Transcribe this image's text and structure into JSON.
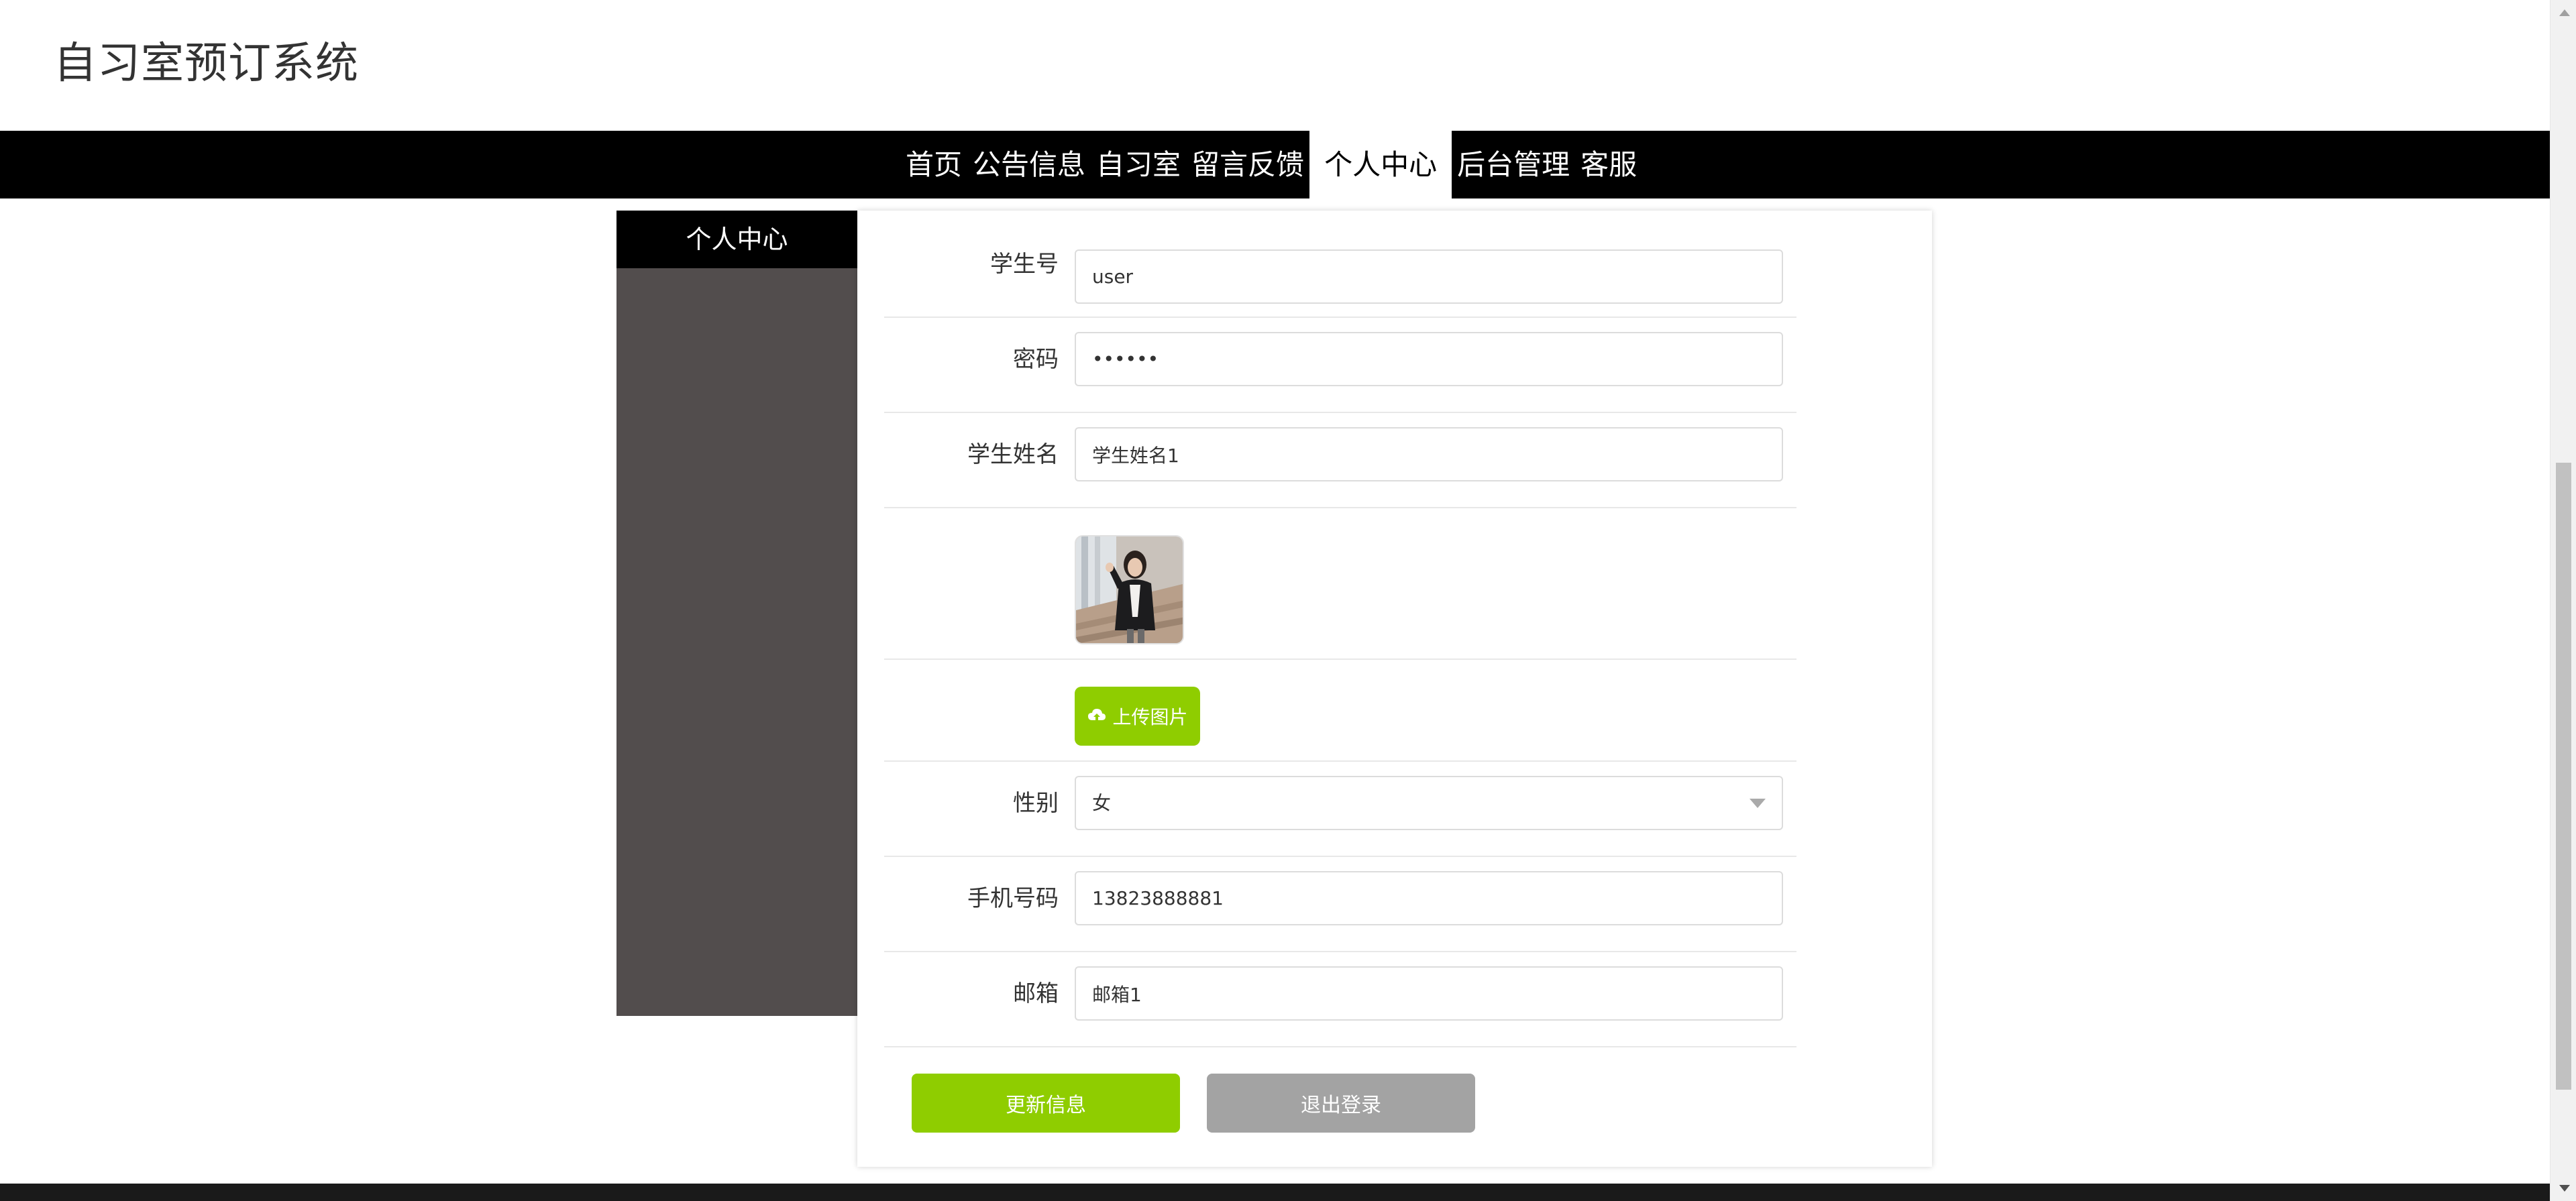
{
  "site": {
    "title": "自习室预订系统"
  },
  "nav": {
    "items": [
      {
        "label": "首页"
      },
      {
        "label": "公告信息"
      },
      {
        "label": "自习室"
      },
      {
        "label": "留言反馈"
      },
      {
        "label": "个人中心",
        "active": true
      },
      {
        "label": "后台管理"
      },
      {
        "label": "客服"
      }
    ]
  },
  "sidebar": {
    "title": "个人中心"
  },
  "form": {
    "student_id": {
      "label": "学生号",
      "value": "user"
    },
    "password": {
      "label": "密码",
      "value": "••••••"
    },
    "student_name": {
      "label": "学生姓名",
      "value": "学生姓名1"
    },
    "upload_button": "上传图片",
    "gender": {
      "label": "性别",
      "value": "女"
    },
    "phone": {
      "label": "手机号码",
      "value": "13823888881"
    },
    "email": {
      "label": "邮箱",
      "value": "邮箱1"
    }
  },
  "actions": {
    "update": "更新信息",
    "logout": "退出登录"
  },
  "colors": {
    "accent": "#8fcd00",
    "nav_bg": "#000000",
    "sidebar_bg": "#524d4d",
    "secondary_button": "#a3a3a3"
  }
}
